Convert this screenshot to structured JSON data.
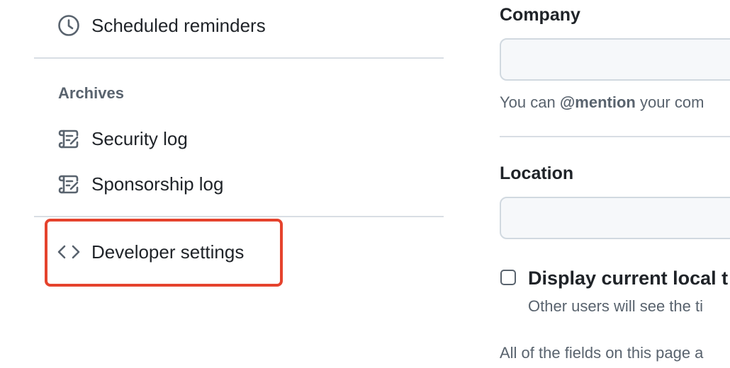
{
  "sidebar": {
    "items_top": [
      {
        "label": "Scheduled reminders",
        "icon": "clock-icon"
      }
    ],
    "archives": {
      "heading": "Archives",
      "items": [
        {
          "label": "Security log",
          "icon": "log-icon"
        },
        {
          "label": "Sponsorship log",
          "icon": "log-icon"
        }
      ]
    },
    "developer": {
      "label": "Developer settings",
      "icon": "code-icon",
      "highlighted": true
    }
  },
  "form": {
    "company": {
      "label": "Company",
      "value": "",
      "help_prefix": "You can ",
      "help_mention": "@mention",
      "help_suffix": " your com"
    },
    "location": {
      "label": "Location",
      "value": ""
    },
    "local_time": {
      "label": "Display current local t",
      "help": "Other users will see the ti",
      "checked": false
    },
    "footer_note": "All of the fields on this page a"
  },
  "colors": {
    "highlight": "#e5432d",
    "muted_text": "#59636e",
    "divider": "#d8dee4",
    "input_bg": "#f6f8fa"
  }
}
